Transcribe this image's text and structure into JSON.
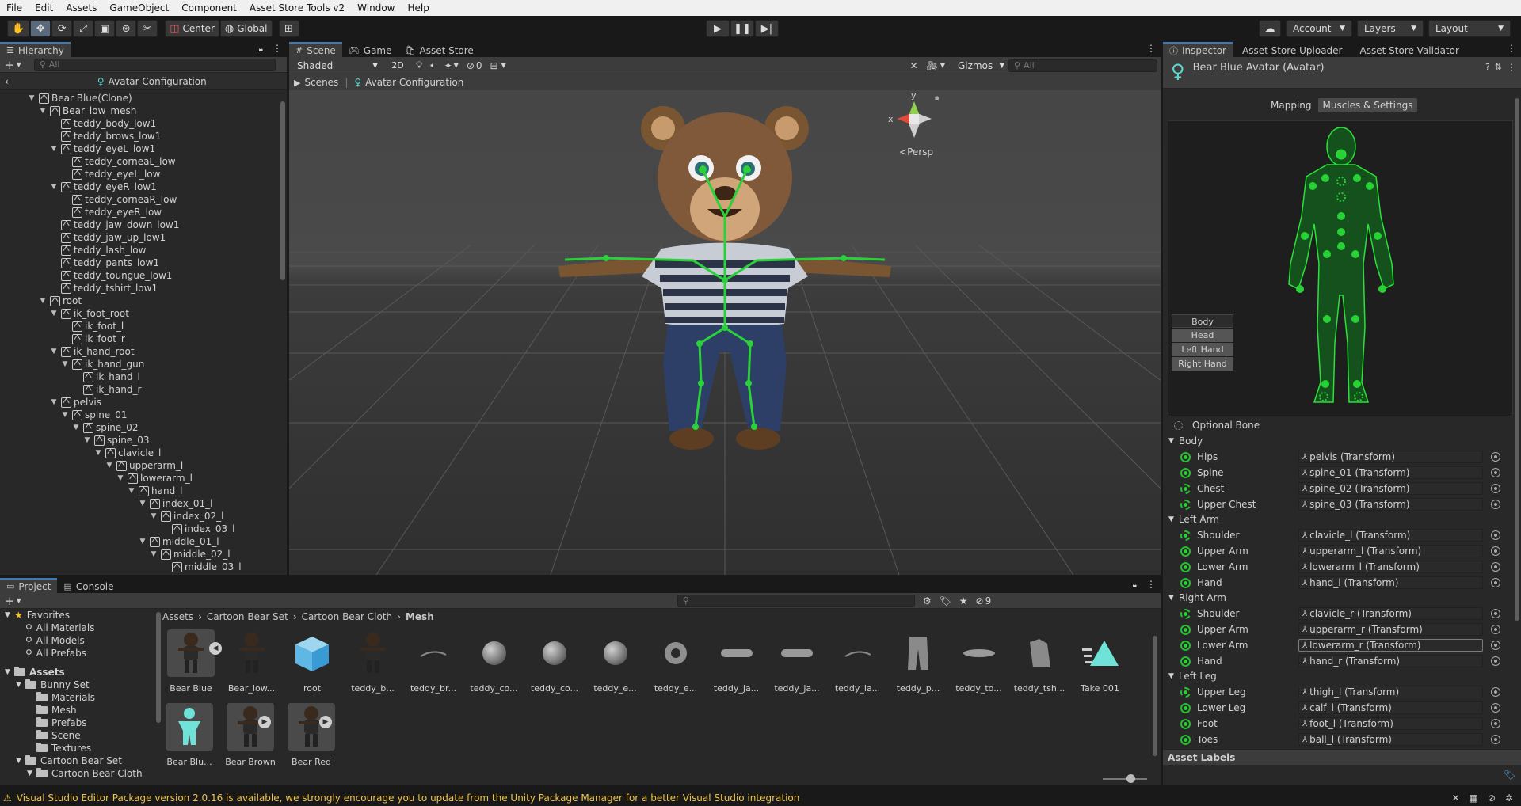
{
  "menu": [
    "File",
    "Edit",
    "Assets",
    "GameObject",
    "Component",
    "Asset Store Tools v2",
    "Window",
    "Help"
  ],
  "toolbar": {
    "center_label": "Center",
    "global_label": "Global",
    "account_label": "Account",
    "layers_label": "Layers",
    "layout_label": "Layout"
  },
  "hierarchy": {
    "tab": "Hierarchy",
    "search_placeholder": "All",
    "breadcrumb": "Avatar Configuration",
    "items": [
      {
        "label": "Bear Blue(Clone)",
        "depth": 0,
        "exp": true
      },
      {
        "label": "Bear_low_mesh",
        "depth": 1,
        "exp": true
      },
      {
        "label": "teddy_body_low1",
        "depth": 2
      },
      {
        "label": "teddy_brows_low1",
        "depth": 2
      },
      {
        "label": "teddy_eyeL_low1",
        "depth": 2,
        "exp": true
      },
      {
        "label": "teddy_corneaL_low",
        "depth": 3
      },
      {
        "label": "teddy_eyeL_low",
        "depth": 3
      },
      {
        "label": "teddy_eyeR_low1",
        "depth": 2,
        "exp": true
      },
      {
        "label": "teddy_corneaR_low",
        "depth": 3
      },
      {
        "label": "teddy_eyeR_low",
        "depth": 3
      },
      {
        "label": "teddy_jaw_down_low1",
        "depth": 2
      },
      {
        "label": "teddy_jaw_up_low1",
        "depth": 2
      },
      {
        "label": "teddy_lash_low",
        "depth": 2
      },
      {
        "label": "teddy_pants_low1",
        "depth": 2
      },
      {
        "label": "teddy_toungue_low1",
        "depth": 2
      },
      {
        "label": "teddy_tshirt_low1",
        "depth": 2
      },
      {
        "label": "root",
        "depth": 1,
        "exp": true
      },
      {
        "label": "ik_foot_root",
        "depth": 2,
        "exp": true
      },
      {
        "label": "ik_foot_l",
        "depth": 3
      },
      {
        "label": "ik_foot_r",
        "depth": 3
      },
      {
        "label": "ik_hand_root",
        "depth": 2,
        "exp": true
      },
      {
        "label": "ik_hand_gun",
        "depth": 3,
        "exp": true
      },
      {
        "label": "ik_hand_l",
        "depth": 4
      },
      {
        "label": "ik_hand_r",
        "depth": 4
      },
      {
        "label": "pelvis",
        "depth": 2,
        "exp": true
      },
      {
        "label": "spine_01",
        "depth": 3,
        "exp": true
      },
      {
        "label": "spine_02",
        "depth": 4,
        "exp": true
      },
      {
        "label": "spine_03",
        "depth": 5,
        "exp": true
      },
      {
        "label": "clavicle_l",
        "depth": 6,
        "exp": true
      },
      {
        "label": "upperarm_l",
        "depth": 7,
        "exp": true
      },
      {
        "label": "lowerarm_l",
        "depth": 8,
        "exp": true
      },
      {
        "label": "hand_l",
        "depth": 9,
        "exp": true
      },
      {
        "label": "index_01_l",
        "depth": 10,
        "exp": true
      },
      {
        "label": "index_02_l",
        "depth": 11,
        "exp": true
      },
      {
        "label": "index_03_l",
        "depth": 12
      },
      {
        "label": "middle_01_l",
        "depth": 10,
        "exp": true
      },
      {
        "label": "middle_02_l",
        "depth": 11,
        "exp": true
      },
      {
        "label": "middle_03_l",
        "depth": 12
      }
    ]
  },
  "scene": {
    "tabs": [
      "Scene",
      "Game",
      "Asset Store"
    ],
    "shading": "Shaded",
    "mode_2d": "2D",
    "hidden_count": "0",
    "gizmos": "Gizmos",
    "search_placeholder": "All",
    "breadcrumb_scenes": "Scenes",
    "breadcrumb_config": "Avatar Configuration",
    "gizmo_y": "y",
    "gizmo_x": "x",
    "persp": "Persp"
  },
  "inspector": {
    "tabs": [
      "Inspector",
      "Asset Store Uploader",
      "Asset Store Validator"
    ],
    "title": "Bear Blue Avatar (Avatar)",
    "mode_tabs": [
      "Mapping",
      "Muscles & Settings"
    ],
    "view_buttons": [
      "Body",
      "Head",
      "Left Hand",
      "Right Hand"
    ],
    "optional_bone": "Optional Bone",
    "groups": [
      {
        "name": "Body",
        "bones": [
          [
            "Hips",
            "pelvis (Transform)"
          ],
          [
            "Spine",
            "spine_01 (Transform)"
          ],
          [
            "Chest",
            "spine_02 (Transform)"
          ],
          [
            "Upper Chest",
            "spine_03 (Transform)"
          ]
        ]
      },
      {
        "name": "Left Arm",
        "bones": [
          [
            "Shoulder",
            "clavicle_l (Transform)"
          ],
          [
            "Upper Arm",
            "upperarm_l (Transform)"
          ],
          [
            "Lower Arm",
            "lowerarm_l (Transform)"
          ],
          [
            "Hand",
            "hand_l (Transform)"
          ]
        ]
      },
      {
        "name": "Right Arm",
        "bones": [
          [
            "Shoulder",
            "clavicle_r (Transform)"
          ],
          [
            "Upper Arm",
            "upperarm_r (Transform)"
          ],
          [
            "Lower Arm",
            "lowerarm_r (Transform)"
          ],
          [
            "Hand",
            "hand_r (Transform)"
          ]
        ]
      },
      {
        "name": "Left Leg",
        "bones": [
          [
            "Upper Leg",
            "thigh_l (Transform)"
          ],
          [
            "Lower Leg",
            "calf_l (Transform)"
          ],
          [
            "Foot",
            "foot_l (Transform)"
          ],
          [
            "Toes",
            "ball_l (Transform)"
          ]
        ]
      }
    ],
    "asset_labels": "Asset Labels"
  },
  "project": {
    "tabs": [
      "Project",
      "Console"
    ],
    "hidden_count": "9",
    "tree": [
      {
        "label": "Favorites",
        "depth": 0,
        "kind": "star"
      },
      {
        "label": "All Materials",
        "depth": 1,
        "kind": "search"
      },
      {
        "label": "All Models",
        "depth": 1,
        "kind": "search"
      },
      {
        "label": "All Prefabs",
        "depth": 1,
        "kind": "search"
      },
      {
        "label": "Assets",
        "depth": 0,
        "kind": "folder",
        "bold": true
      },
      {
        "label": "Bunny Set",
        "depth": 1,
        "kind": "folder"
      },
      {
        "label": "Materials",
        "depth": 2,
        "kind": "folder"
      },
      {
        "label": "Mesh",
        "depth": 2,
        "kind": "folder"
      },
      {
        "label": "Prefabs",
        "depth": 2,
        "kind": "folder"
      },
      {
        "label": "Scene",
        "depth": 2,
        "kind": "folder"
      },
      {
        "label": "Textures",
        "depth": 2,
        "kind": "folder"
      },
      {
        "label": "Cartoon Bear Set",
        "depth": 1,
        "kind": "folder"
      },
      {
        "label": "Cartoon Bear Cloth",
        "depth": 2,
        "kind": "folder"
      }
    ],
    "breadcrumb": [
      "Assets",
      "Cartoon Bear Set",
      "Cartoon Bear Cloth",
      "Mesh"
    ],
    "assets_row1": [
      {
        "name": "Bear Blue",
        "kind": "bear"
      },
      {
        "name": "Bear_low...",
        "kind": "bear"
      },
      {
        "name": "root",
        "kind": "cube"
      },
      {
        "name": "teddy_b...",
        "kind": "bear"
      },
      {
        "name": "teddy_br...",
        "kind": "brow"
      },
      {
        "name": "teddy_co...",
        "kind": "sphere"
      },
      {
        "name": "teddy_co...",
        "kind": "sphere"
      },
      {
        "name": "teddy_e...",
        "kind": "sphere"
      },
      {
        "name": "teddy_e...",
        "kind": "eye"
      },
      {
        "name": "teddy_ja...",
        "kind": "jaw"
      },
      {
        "name": "teddy_ja...",
        "kind": "jaw"
      },
      {
        "name": "teddy_la...",
        "kind": "brow"
      },
      {
        "name": "teddy_p...",
        "kind": "pants"
      },
      {
        "name": "teddy_to...",
        "kind": "tongue"
      },
      {
        "name": "teddy_tsh...",
        "kind": "shirt"
      },
      {
        "name": "Take 001",
        "kind": "anim"
      }
    ],
    "assets_row2": [
      {
        "name": "Bear Blu...",
        "kind": "avatar"
      },
      {
        "name": "Bear Brown",
        "kind": "bear"
      },
      {
        "name": "Bear Red",
        "kind": "bear"
      }
    ]
  },
  "status": {
    "message": "Visual Studio Editor Package version 2.0.16 is available, we strongly encourage you to update from the Unity Package Manager for a better Visual Studio integration"
  },
  "colors": {
    "accent": "#3a79bb",
    "bone_green": "#24c12f",
    "warning": "#f0c64a"
  }
}
